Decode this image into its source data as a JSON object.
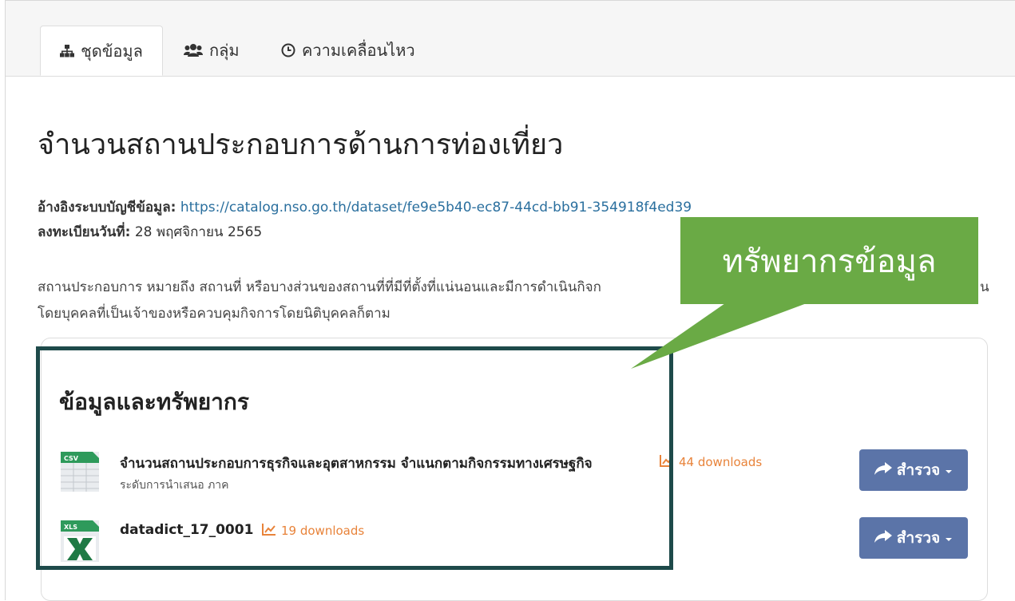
{
  "tabs": [
    {
      "label": "ชุดข้อมูล",
      "icon": "sitemap-icon",
      "active": true
    },
    {
      "label": "กลุ่ม",
      "icon": "users-icon",
      "active": false
    },
    {
      "label": "ความเคลื่อนไหว",
      "icon": "clock-icon",
      "active": false
    }
  ],
  "dataset": {
    "title": "จำนวนสถานประกอบการด้านการท่องเที่ยว",
    "catalog_label": "อ้างอิงระบบบัญชีข้อมูล:",
    "catalog_url": "https://catalog.nso.go.th/dataset/fe9e5b40-ec87-44cd-bb91-354918f4ed39",
    "registered_label": "ลงทะเบียนวันที่:",
    "registered_date": "28 พฤศจิกายน 2565",
    "description_line1": "สถานประกอบการ หมายถึง สถานที่ หรือบางส่วนของสถานที่ที่มีที่ตั้งที่แน่นอนและมีการดำเนินกิจก",
    "description_line2": "โดยบุคคลที่เป็นเจ้าของหรือควบคุมกิจการโดยนิติบุคคลก็ตาม",
    "description_cut": "น"
  },
  "resources": {
    "heading": "ข้อมูลและทรัพยากร",
    "items": [
      {
        "format": "CSV",
        "name": "จำนวนสถานประกอบการธุรกิจและอุตสาหกรรม จำแนกตามกิจกรรมทางเศรษฐกิจ",
        "downloads": "44 downloads",
        "subtitle": "ระดับการนำเสนอ ภาค",
        "button": "สำรวจ"
      },
      {
        "format": "XLS",
        "name": "datadict_17_0001",
        "downloads": "19 downloads",
        "subtitle": "",
        "button": "สำรวจ"
      }
    ]
  },
  "callout": {
    "text": "ทรัพยากรข้อมูล",
    "color": "#6aaa45"
  },
  "colors": {
    "highlight_border": "#1e4a4a",
    "button": "#5b74a8",
    "downloads": "#e8833a",
    "link": "#2a6f9e"
  }
}
